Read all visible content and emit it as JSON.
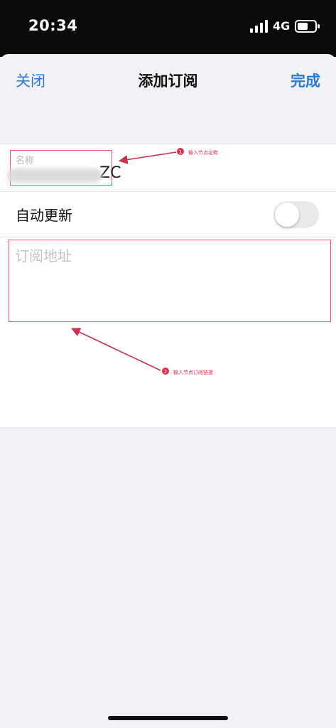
{
  "status_bar": {
    "time": "20:34",
    "network": "4G",
    "signal_icon": "cellular-signal-icon",
    "battery_icon": "battery-icon"
  },
  "nav": {
    "close_label": "关闭",
    "title": "添加订阅",
    "done_label": "完成"
  },
  "form": {
    "name_label": "名称",
    "name_value": "…ZC",
    "auto_update_label": "自动更新",
    "auto_update_on": false,
    "url_placeholder": "订阅地址"
  },
  "annotations": [
    {
      "number": "1",
      "text": "输入节点名称"
    },
    {
      "number": "2",
      "text": "输入节点订阅链接"
    }
  ],
  "colors": {
    "accent": "#2a7ad1",
    "annotation": "#e0556f",
    "status_bar_bg": "#0b0b0c",
    "background": "#f1f1f6"
  }
}
